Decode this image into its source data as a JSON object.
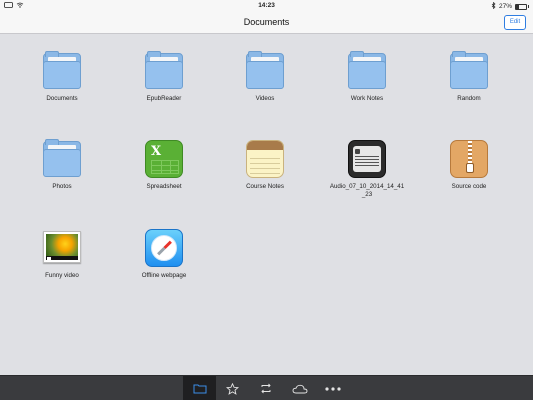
{
  "status": {
    "time": "14:23",
    "battery_text": "27%",
    "left_icons": [
      "ipad-icon",
      "wifi-icon"
    ],
    "right_icons": [
      "bluetooth-icon",
      "battery-icon"
    ]
  },
  "nav": {
    "title": "Documents",
    "edit_label": "Edit"
  },
  "items": [
    {
      "label": "Documents",
      "icon": "folder-icon"
    },
    {
      "label": "EpubReader",
      "icon": "folder-icon"
    },
    {
      "label": "Videos",
      "icon": "folder-icon"
    },
    {
      "label": "Work Notes",
      "icon": "folder-icon"
    },
    {
      "label": "Random",
      "icon": "folder-icon"
    },
    {
      "label": "Photos",
      "icon": "folder-icon"
    },
    {
      "label": "Spreadsheet",
      "icon": "spreadsheet-icon"
    },
    {
      "label": "Course Notes",
      "icon": "notes-icon"
    },
    {
      "label": "Audio_07_10_2014_14_41\n_23",
      "icon": "audio-recorder-icon"
    },
    {
      "label": "Source code",
      "icon": "zip-archive-icon"
    },
    {
      "label": "Funny video",
      "icon": "video-icon"
    },
    {
      "label": "Offline webpage",
      "icon": "safari-compass-icon"
    }
  ],
  "tabbar": {
    "active": "files",
    "tabs": [
      {
        "id": "files",
        "icon": "folder-icon"
      },
      {
        "id": "favorites",
        "icon": "star-icon"
      },
      {
        "id": "transfer",
        "icon": "sync-icon"
      },
      {
        "id": "cloud",
        "icon": "cloud-icon"
      },
      {
        "id": "more",
        "icon": "more-dots-icon"
      }
    ]
  },
  "colors": {
    "accent": "#2f7de1",
    "background": "#dfe0e4",
    "tabbar": "#3a3b3e",
    "folder": "#8bb8e6"
  }
}
